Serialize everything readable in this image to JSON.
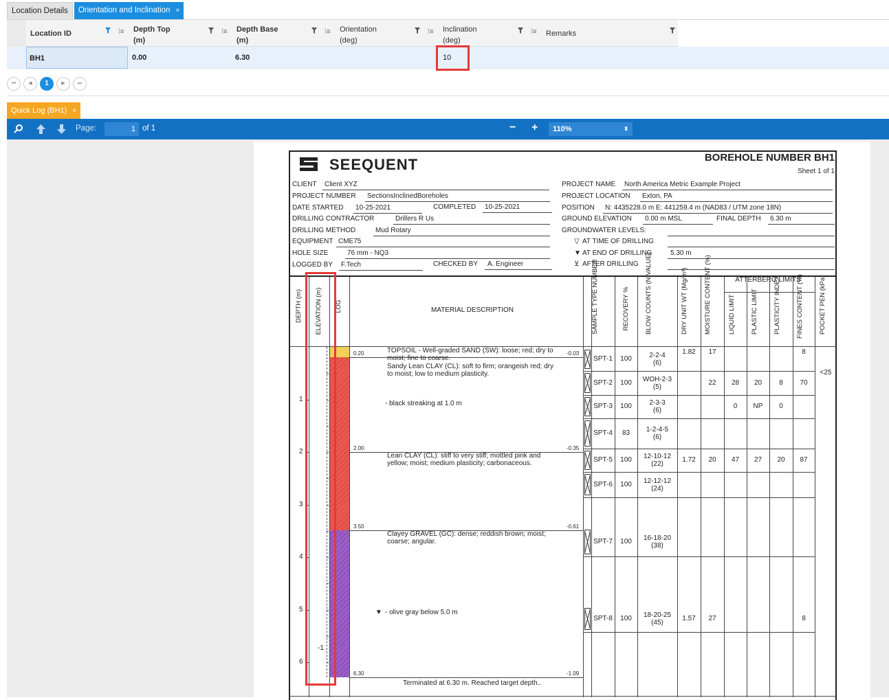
{
  "tabs": {
    "location": "Location Details",
    "orientation": "Orientation and Inclination",
    "close": "×"
  },
  "grid": {
    "headers": [
      {
        "line1": "Location ID",
        "line2": ""
      },
      {
        "line1": "Depth Top",
        "line2": "(m)"
      },
      {
        "line1": "Depth Base",
        "line2": "(m)"
      },
      {
        "line1": "Orientation",
        "line2": "(deg)"
      },
      {
        "line1": "Inclination",
        "line2": "(deg)"
      },
      {
        "line1": "Remarks",
        "line2": ""
      }
    ],
    "row": {
      "location_id": "BH1",
      "depth_top": "0.00",
      "depth_base": "6.30",
      "orientation": "",
      "inclination": "10",
      "remarks": ""
    }
  },
  "pager": {
    "first": "⏮",
    "prev": "◀",
    "page": "1",
    "next": "▶",
    "last": "⏭"
  },
  "quicklog": {
    "tab": "Quick Log (BH1)",
    "close": "×"
  },
  "toolbar": {
    "page_label": "Page:",
    "page_value": "1",
    "of": "of 1",
    "minus": "−",
    "plus": "+",
    "zoom": "110%"
  },
  "log": {
    "logo": "SEEQUENT",
    "title": "BOREHOLE NUMBER BH1",
    "sheet": "Sheet 1 of 1",
    "info_left": [
      {
        "label": "CLIENT",
        "value": "Client XYZ"
      },
      {
        "label": "PROJECT NUMBER",
        "value": "SectionsInclinedBoreholes"
      },
      {
        "label": "DATE STARTED",
        "value": "10-25-2021"
      },
      {
        "label": "DRILLING CONTRACTOR",
        "value": "Drillers R Us"
      },
      {
        "label": "DRILLING METHOD",
        "value": "Mud Rotary"
      },
      {
        "label": "EQUIPMENT",
        "value": "CME75"
      },
      {
        "label": "HOLE SIZE",
        "value": "76 mm - NQ3"
      },
      {
        "label": "LOGGED BY",
        "value": "F.Tech"
      }
    ],
    "completed": {
      "label": "COMPLETED",
      "value": "10-25-2021"
    },
    "checked": {
      "label": "CHECKED BY",
      "value": "A. Engineer"
    },
    "info_right": [
      {
        "label": "PROJECT NAME",
        "value": "North America Metric Example Project"
      },
      {
        "label": "PROJECT LOCATION",
        "value": "Exton, PA"
      },
      {
        "label": "POSITION",
        "value": "N: 4435228.0 m E: 441259.4 m (NAD83 / UTM zone 18N)"
      },
      {
        "label": "GROUND ELEVATION",
        "value": "0.00 m MSL"
      }
    ],
    "final_depth": {
      "label": "FINAL DEPTH",
      "value": "6.30 m"
    },
    "gw": {
      "title": "GROUNDWATER LEVELS:",
      "atd": "AT TIME OF DRILLING",
      "aed": "AT END OF DRILLING",
      "aed_value": "5.30 m",
      "after": "AFTER DRILLING"
    },
    "col_headers": {
      "depth": "DEPTH (m)",
      "elev": "ELEVATION (m)",
      "graphic": "GRAPHIC LOG",
      "material": "MATERIAL DESCRIPTION",
      "sample": "SAMPLE TYPE NUMBER",
      "recovery": "RECOVERY %",
      "blow": "BLOW COUNTS (N VALUE)",
      "dry": "DRY UNIT WT (Mg/m³)",
      "moisture": "MOISTURE CONTENT (%)",
      "atterberg": "ATTERBERG LIMITS",
      "ll": "LIQUID LIMIT",
      "pl": "PLASTIC LIMIT",
      "pi": "PLASTICITY INDEX",
      "fines": "FINES CONTENT (%)",
      "pocket": "POCKET PEN (kPa)"
    },
    "depth_ticks": [
      "1",
      "2",
      "3",
      "4",
      "5",
      "6"
    ],
    "elev_tick": "-1",
    "strata": [
      {
        "top": "0.20",
        "elev": "-0.03",
        "text": "TOPSOIL - Well-graded SAND (SW): loose; red; dry to moist; fine to coarse."
      },
      {
        "top": "",
        "elev": "",
        "text": "Sandy Lean CLAY (CL): soft to firm; orangeish red; dry to moist; low to medium plasticity."
      },
      {
        "top": "",
        "elev": "",
        "text": "- black streaking at 1.0 m"
      },
      {
        "top": "2.00",
        "elev": "-0.35",
        "text": "Lean CLAY (CL): stiff to very stiff; mottled pink and yellow; moist; medium plasticity; carbonaceous."
      },
      {
        "top": "3.50",
        "elev": "-0.61",
        "text": "Clayey GRAVEL (GC): dense; reddish brown; moist; coarse; angular."
      },
      {
        "top": "",
        "elev": "",
        "text": "- olive gray below 5.0 m"
      },
      {
        "top": "6.30",
        "elev": "-1.09",
        "text": "Terminated at 6.30 m. Reached target depth.."
      }
    ],
    "samples": [
      {
        "id": "SPT-1",
        "rec": "100",
        "blow": "2-2-4",
        "n": "(6)",
        "dry": "1.82",
        "mc": "17",
        "ll": "",
        "pl": "",
        "pi": "",
        "fines": "8",
        "pp": ""
      },
      {
        "id": "SPT-2",
        "rec": "100",
        "blow": "WOH-2-3",
        "n": "(5)",
        "dry": "",
        "mc": "22",
        "ll": "28",
        "pl": "20",
        "pi": "8",
        "fines": "70",
        "pp": "<25"
      },
      {
        "id": "SPT-3",
        "rec": "100",
        "blow": "2-3-3",
        "n": "(6)",
        "dry": "",
        "mc": "",
        "ll": "0",
        "pl": "NP",
        "pi": "0",
        "fines": "",
        "pp": ""
      },
      {
        "id": "SPT-4",
        "rec": "83",
        "blow": "1-2-4-5",
        "n": "(6)",
        "dry": "",
        "mc": "",
        "ll": "",
        "pl": "",
        "pi": "",
        "fines": "",
        "pp": ""
      },
      {
        "id": "SPT-5",
        "rec": "100",
        "blow": "12-10-12",
        "n": "(22)",
        "dry": "1.72",
        "mc": "20",
        "ll": "47",
        "pl": "27",
        "pi": "20",
        "fines": "87",
        "pp": ""
      },
      {
        "id": "SPT-6",
        "rec": "100",
        "blow": "12-12-12",
        "n": "(24)",
        "dry": "",
        "mc": "",
        "ll": "",
        "pl": "",
        "pi": "",
        "fines": "",
        "pp": ""
      },
      {
        "id": "SPT-7",
        "rec": "100",
        "blow": "16-18-20",
        "n": "(38)",
        "dry": "",
        "mc": "",
        "ll": "",
        "pl": "",
        "pi": "",
        "fines": "",
        "pp": ""
      },
      {
        "id": "SPT-8",
        "rec": "100",
        "blow": "18-20-25",
        "n": "(45)",
        "dry": "1.57",
        "mc": "27",
        "ll": "",
        "pl": "",
        "pi": "",
        "fines": "8",
        "pp": ""
      }
    ]
  },
  "colors": {
    "accent": "#1b8ee0",
    "toolbar": "#1371c4",
    "quicklog": "#f5a623",
    "highlight": "#e53935",
    "topsoil": "#f2d05a",
    "clay": "#e85a4f",
    "gravel": "#9b5fc7"
  }
}
